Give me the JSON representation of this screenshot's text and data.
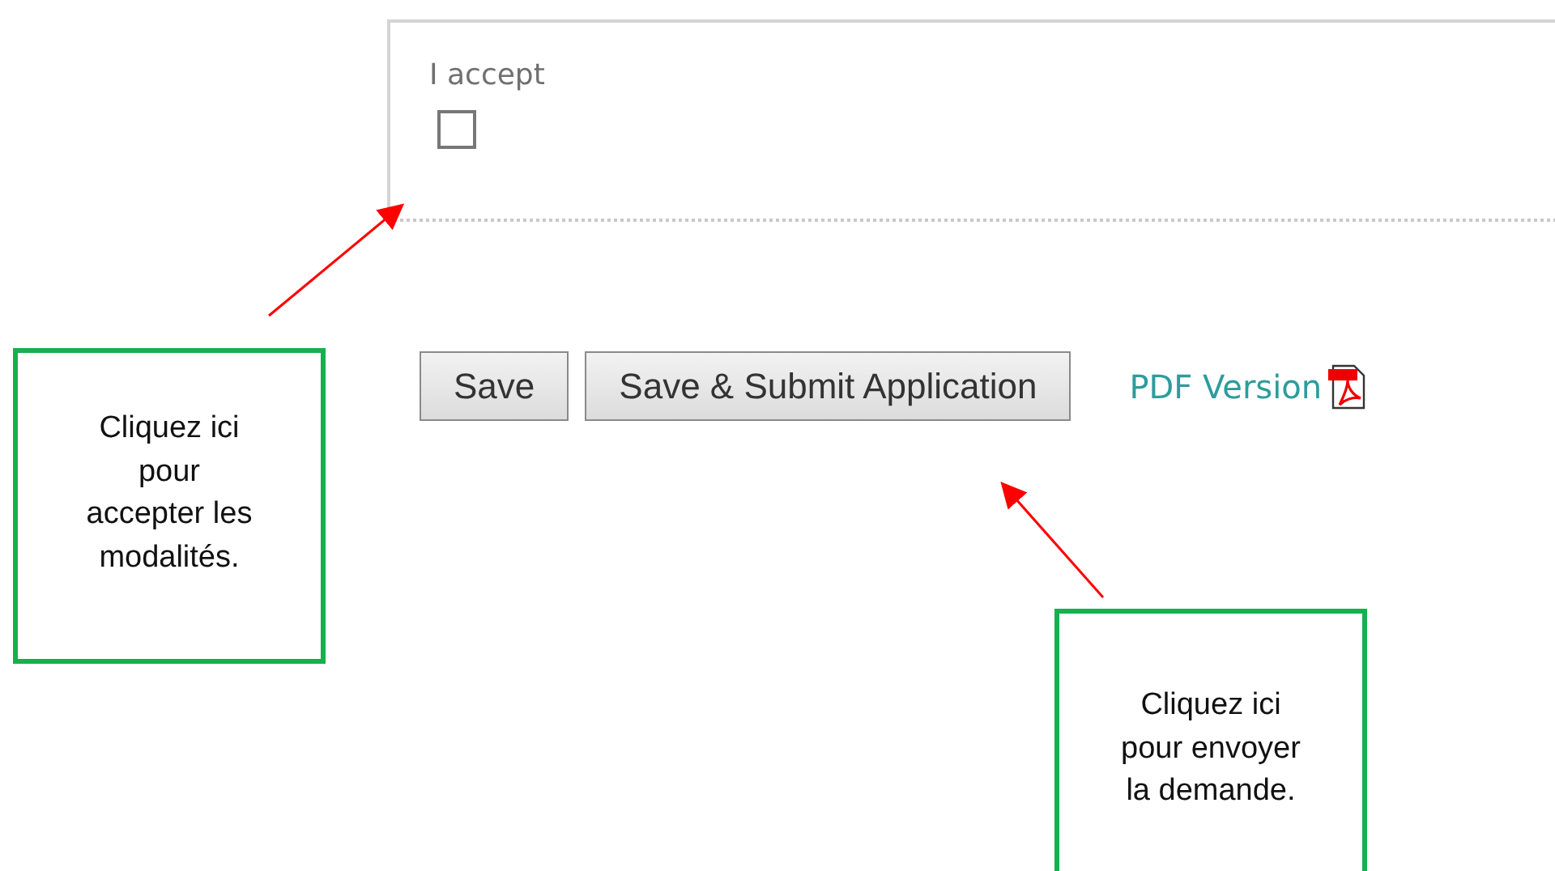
{
  "form_panel": {
    "label": "I accept",
    "checkbox": {
      "checked": false
    }
  },
  "buttons": [
    {
      "label": "Save"
    },
    {
      "label": "Save & Submit Application"
    }
  ],
  "pdf_link": {
    "label": "PDF Version"
  },
  "callouts": [
    {
      "text": "Cliquez ici\npour\naccepter les\nmodalités."
    },
    {
      "text": "Cliquez ici\npour envoyer\nla demande."
    }
  ]
}
